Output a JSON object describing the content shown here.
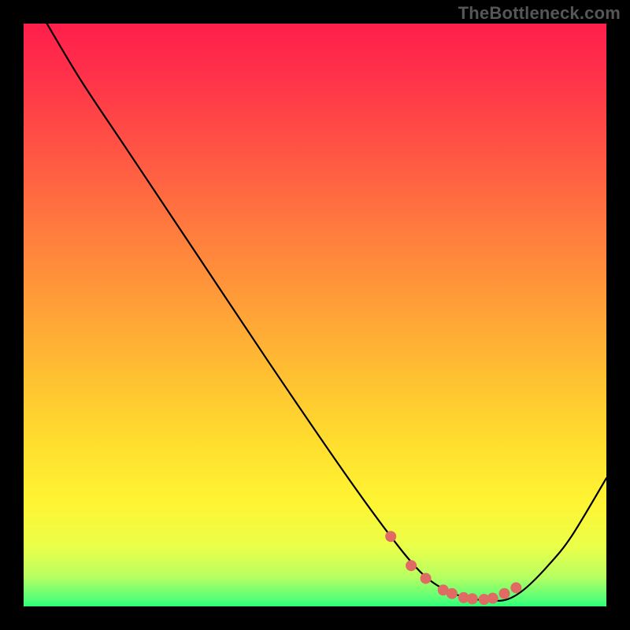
{
  "watermark": "TheBottleneck.com",
  "chart_data": {
    "type": "line",
    "title": "",
    "xlabel": "",
    "ylabel": "",
    "xlim": [
      0,
      1
    ],
    "ylim": [
      0,
      1
    ],
    "grid": false,
    "legend": false,
    "background": "red-yellow-green vertical gradient",
    "series": [
      {
        "name": "bottleneck-curve",
        "color": "#000000",
        "x": [
          0.04,
          0.1,
          0.18,
          0.3,
          0.42,
          0.55,
          0.63,
          0.68,
          0.72,
          0.76,
          0.8,
          0.83,
          0.86,
          0.9,
          0.94,
          1.0
        ],
        "y": [
          1.0,
          0.9,
          0.78,
          0.6,
          0.42,
          0.23,
          0.12,
          0.06,
          0.03,
          0.015,
          0.01,
          0.012,
          0.03,
          0.07,
          0.12,
          0.22
        ]
      }
    ],
    "markers": {
      "name": "highlight-dots",
      "color": "#e06a64",
      "radius_px": 7,
      "x": [
        0.63,
        0.665,
        0.69,
        0.72,
        0.735,
        0.755,
        0.77,
        0.79,
        0.805,
        0.825,
        0.845
      ],
      "y": [
        0.12,
        0.07,
        0.048,
        0.028,
        0.022,
        0.015,
        0.013,
        0.012,
        0.014,
        0.022,
        0.032
      ]
    }
  }
}
